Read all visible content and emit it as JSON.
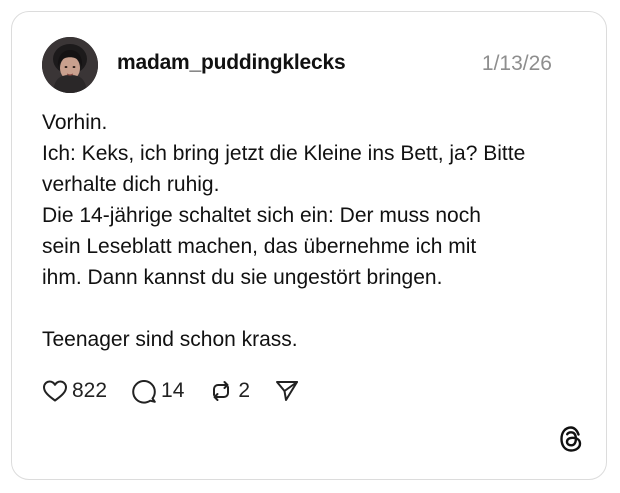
{
  "post": {
    "username": "madam_puddingklecks",
    "date": "1/13/26",
    "lines": [
      "Vorhin.",
      "Ich: Keks, ich bring jetzt die Kleine ins Bett, ja? Bitte",
      "verhalte dich ruhig.",
      "Die 14-jährige schaltet sich ein: Der muss noch",
      "sein Leseblatt machen, das übernehme ich mit",
      "ihm. Dann kannst du sie ungestört bringen.",
      "Teenager sind schon krass."
    ]
  },
  "actions": {
    "likes": "822",
    "replies": "14",
    "reposts": "2"
  },
  "icons": {
    "like": "heart-icon",
    "reply": "speech-bubble-icon",
    "repost": "repost-icon",
    "share": "send-icon",
    "brand": "threads-logo-icon"
  }
}
